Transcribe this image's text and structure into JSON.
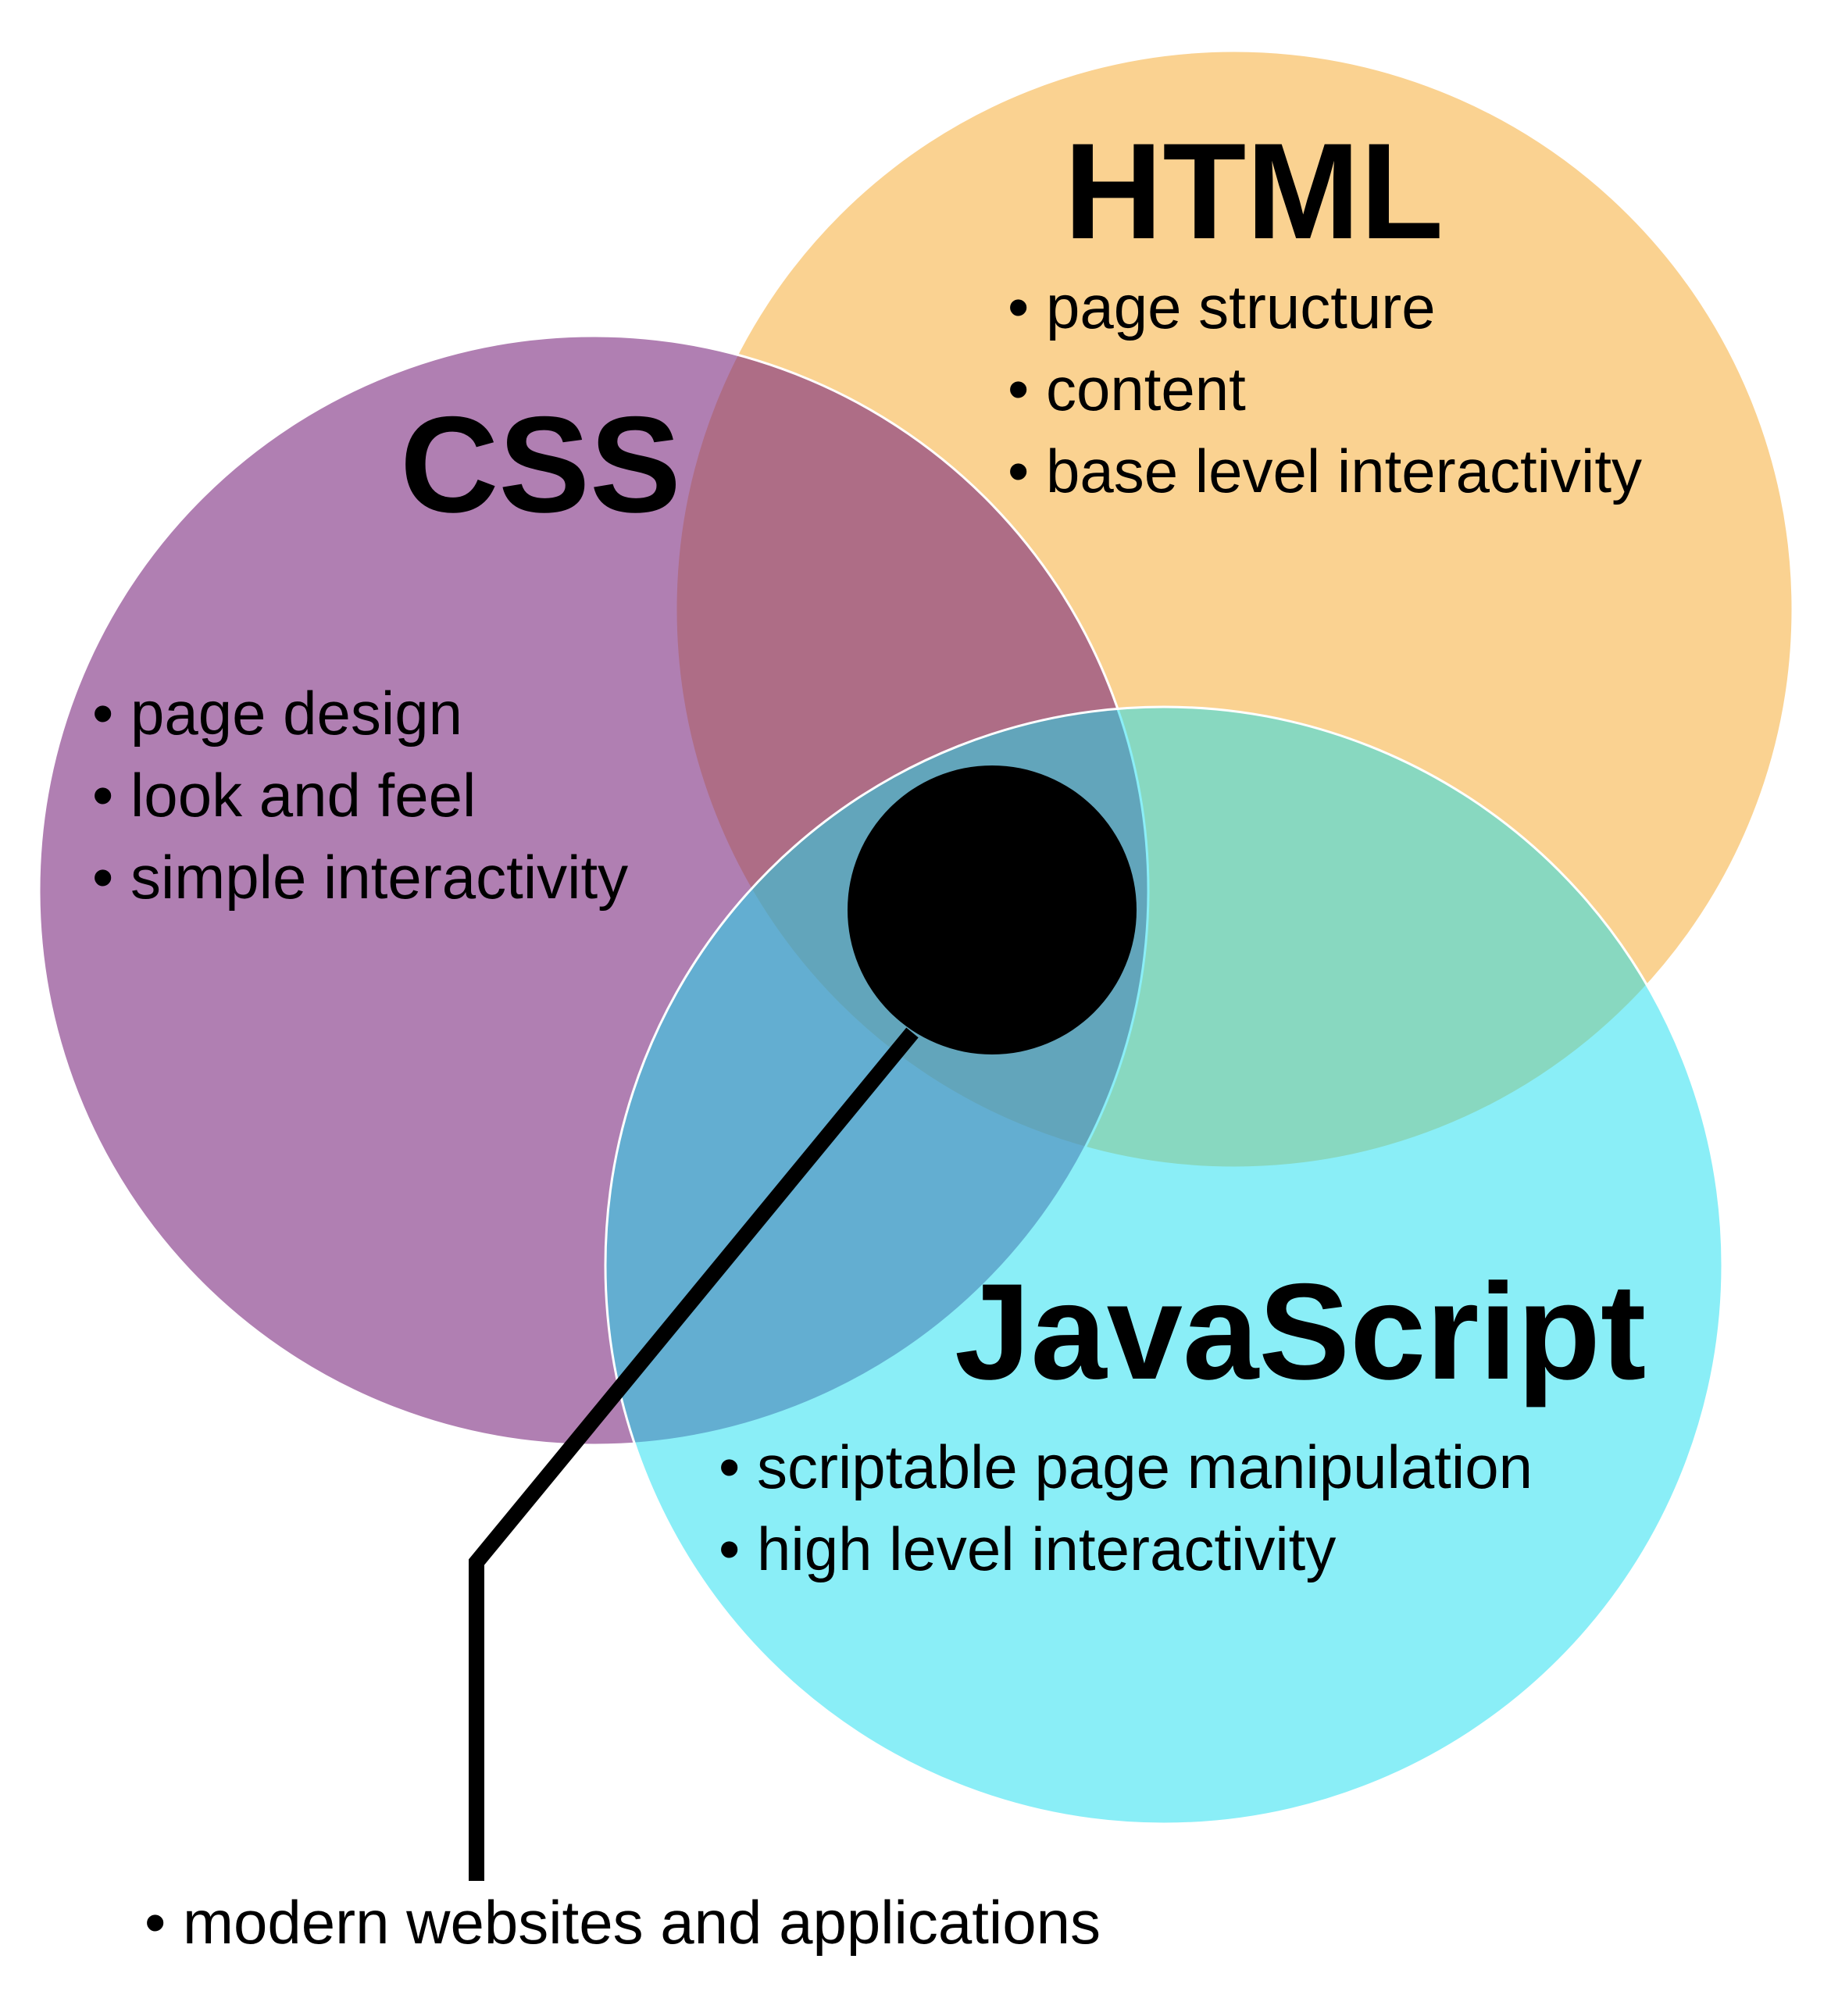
{
  "venn": {
    "sets": [
      {
        "key": "html",
        "title": "HTML",
        "color": "#F6A623",
        "items": [
          "• page structure",
          "• content",
          "• base level interactivity"
        ]
      },
      {
        "key": "css",
        "title": "CSS",
        "color": "#7B2A7E",
        "items": [
          "• page design",
          "• look and feel",
          "• simple interactivity"
        ]
      },
      {
        "key": "javascript",
        "title": "JavaScript",
        "color": "#16DDF0",
        "items": [
          "• scriptable page manipulation",
          "• high level interactivity"
        ]
      }
    ],
    "intersection": {
      "color": "#000000",
      "label": "• modern websites and applications"
    }
  }
}
